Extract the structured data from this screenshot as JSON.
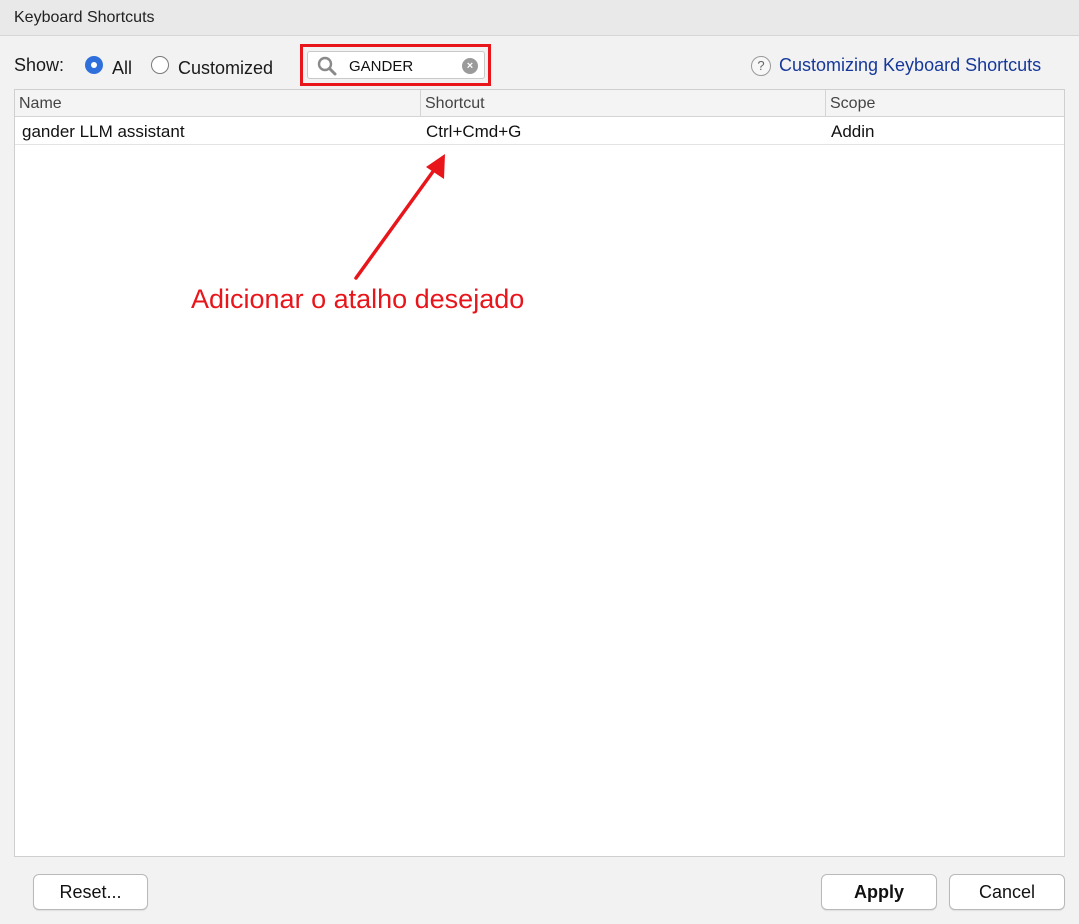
{
  "window": {
    "title": "Keyboard Shortcuts"
  },
  "filter": {
    "show_label": "Show:",
    "options": [
      {
        "label": "All",
        "checked": true
      },
      {
        "label": "Customized",
        "checked": false
      }
    ]
  },
  "search": {
    "value": "GANDER",
    "placeholder": ""
  },
  "help": {
    "icon_text": "?",
    "link_label": "Customizing Keyboard Shortcuts"
  },
  "table": {
    "columns": [
      "Name",
      "Shortcut",
      "Scope"
    ],
    "rows": [
      {
        "name": "gander LLM assistant",
        "shortcut": "Ctrl+Cmd+G",
        "scope": "Addin"
      }
    ]
  },
  "annotation": {
    "text": "Adicionar o atalho desejado",
    "color": "#e8151b"
  },
  "buttons": {
    "reset": "Reset...",
    "apply": "Apply",
    "cancel": "Cancel"
  },
  "colors": {
    "accent": "#2f6fdc",
    "link": "#16389a",
    "highlight": "#e8151b"
  }
}
